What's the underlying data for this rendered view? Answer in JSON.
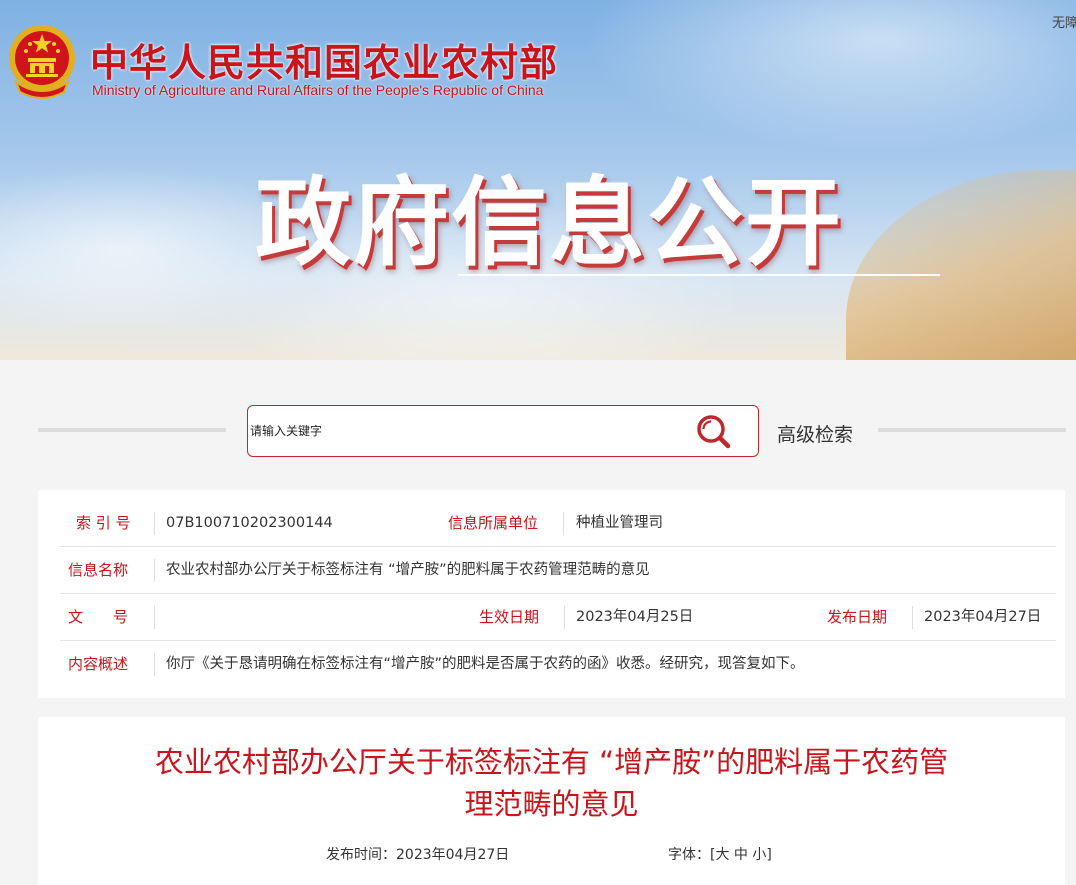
{
  "header": {
    "ministry_name_cn": "中华人民共和国农业农村部",
    "ministry_name_en": "Ministry of Agriculture and Rural Affairs of the People's Republic of China",
    "accessibility_link": "无障碍",
    "section_title": "政府信息公开",
    "emblem_icon": "national-emblem-icon"
  },
  "search": {
    "placeholder": "请输入关键字",
    "advanced_label": "高级检索",
    "search_icon": "search-icon"
  },
  "info": {
    "index_label": "索 引 号",
    "index_value": "07B100710202300144",
    "unit_label": "信息所属单位",
    "unit_value": "种植业管理司",
    "name_label": "信息名称",
    "name_value": "农业农村部办公厅关于标签标注有 “增产胺”的肥料属于农药管理范畴的意见",
    "doc_no_label": "文　　号",
    "doc_no_value": "",
    "effective_label": "生效日期",
    "effective_value": "2023年04月25日",
    "published_label": "发布日期",
    "published_value": "2023年04月27日",
    "summary_label": "内容概述",
    "summary_value": "你厅《关于恳请明确在标签标注有“增产胺”的肥料是否属于农药的函》收悉。经研究，现答复如下。"
  },
  "article": {
    "title_line1": "农业农村部办公厅关于标签标注有 “增产胺”的肥料属于农药管",
    "title_line2": "理范畴的意见",
    "publish_time": "发布时间：2023年04月27日",
    "font_label": "字体：[",
    "font_large": "大",
    "font_medium": "中",
    "font_small": "小",
    "font_close": "]"
  },
  "colors": {
    "accent_red": "#c8141a",
    "banner_sky": "#7fb1e3",
    "page_bg": "#f4f4f4"
  }
}
